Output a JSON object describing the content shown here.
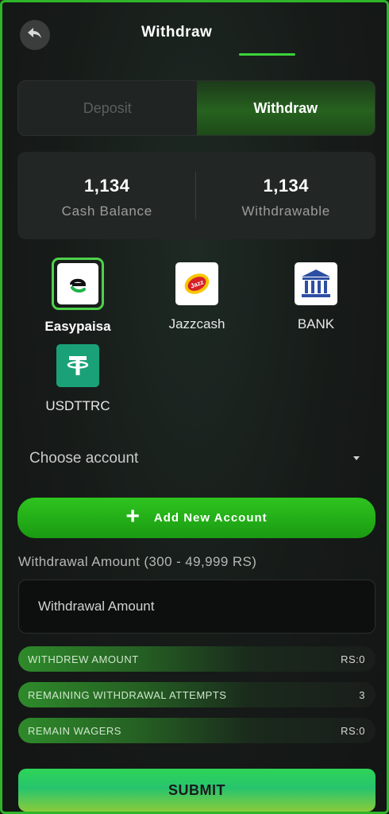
{
  "header": {
    "title": "Withdraw",
    "back_icon": "back-arrow-icon"
  },
  "tabs": {
    "deposit": "Deposit",
    "withdraw": "Withdraw",
    "active": "Withdraw"
  },
  "balances": {
    "cash_value": "1,134",
    "cash_label": "Cash Balance",
    "withdrawable_value": "1,134",
    "withdrawable_label": "Withdrawable"
  },
  "methods": [
    {
      "label": "Easypaisa",
      "icon": "easypaisa-icon",
      "selected": true
    },
    {
      "label": "Jazzcash",
      "icon": "jazzcash-icon",
      "selected": false
    },
    {
      "label": "BANK",
      "icon": "bank-icon",
      "selected": false
    },
    {
      "label": "USDTTRC",
      "icon": "tether-icon",
      "selected": false
    }
  ],
  "account_select": {
    "value": "Choose account"
  },
  "add_account": {
    "label": "Add New Account"
  },
  "amount": {
    "label": "Withdrawal Amount (300 - 49,999 RS)",
    "placeholder": "Withdrawal Amount"
  },
  "stats": [
    {
      "key": "WITHDREW AMOUNT",
      "value": "RS:0"
    },
    {
      "key": "REMAINING WITHDRAWAL ATTEMPTS",
      "value": "3"
    },
    {
      "key": "REMAIN WAGERS",
      "value": "RS:0"
    }
  ],
  "submit": {
    "label": "SUBMIT"
  },
  "colors": {
    "accent": "#2fb52a",
    "tab_active": "#27621f",
    "submit": "#2dd457"
  }
}
